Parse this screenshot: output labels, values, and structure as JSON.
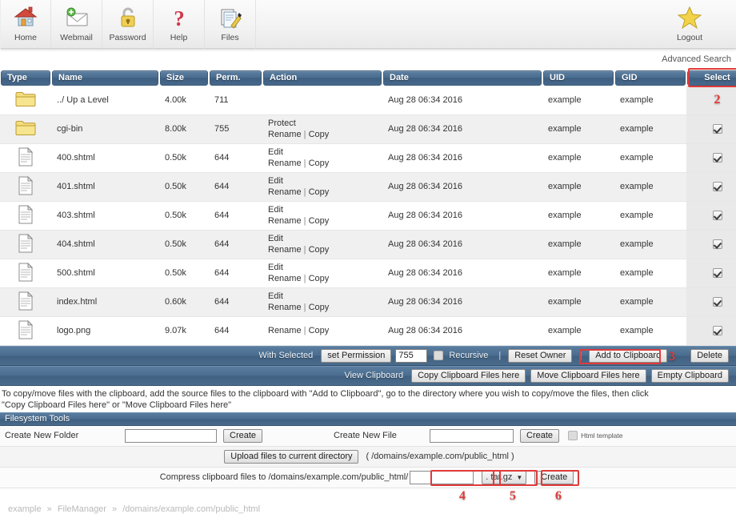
{
  "topnav": {
    "items": [
      {
        "label": "Home",
        "icon": "home-icon"
      },
      {
        "label": "Webmail",
        "icon": "envelope-icon"
      },
      {
        "label": "Password",
        "icon": "padlock-icon"
      },
      {
        "label": "Help",
        "icon": "question-mark-icon"
      },
      {
        "label": "Files",
        "icon": "files-pencil-icon"
      }
    ],
    "logout": {
      "label": "Logout",
      "icon": "star-icon"
    }
  },
  "advanced_search": "Advanced Search",
  "table": {
    "columns": [
      "Type",
      "Name",
      "Size",
      "Perm.",
      "Action",
      "Date",
      "UID",
      "GID",
      "Select"
    ],
    "rows": [
      {
        "type": "folder-icon",
        "name": "../ Up a Level",
        "size": "4.00k",
        "perm": "711",
        "actions": [],
        "date": "Aug 28 06:34 2016",
        "uid": "example",
        "gid": "example",
        "selected": null
      },
      {
        "type": "folder-icon",
        "name": "cgi-bin",
        "size": "8.00k",
        "perm": "755",
        "actions": [
          "Protect",
          "Rename",
          "Copy"
        ],
        "date": "Aug 28 06:34 2016",
        "uid": "example",
        "gid": "example",
        "selected": true
      },
      {
        "type": "file-icon",
        "name": "400.shtml",
        "size": "0.50k",
        "perm": "644",
        "actions": [
          "Edit",
          "Rename",
          "Copy"
        ],
        "date": "Aug 28 06:34 2016",
        "uid": "example",
        "gid": "example",
        "selected": true
      },
      {
        "type": "file-icon",
        "name": "401.shtml",
        "size": "0.50k",
        "perm": "644",
        "actions": [
          "Edit",
          "Rename",
          "Copy"
        ],
        "date": "Aug 28 06:34 2016",
        "uid": "example",
        "gid": "example",
        "selected": true
      },
      {
        "type": "file-icon",
        "name": "403.shtml",
        "size": "0.50k",
        "perm": "644",
        "actions": [
          "Edit",
          "Rename",
          "Copy"
        ],
        "date": "Aug 28 06:34 2016",
        "uid": "example",
        "gid": "example",
        "selected": true
      },
      {
        "type": "file-icon",
        "name": "404.shtml",
        "size": "0.50k",
        "perm": "644",
        "actions": [
          "Edit",
          "Rename",
          "Copy"
        ],
        "date": "Aug 28 06:34 2016",
        "uid": "example",
        "gid": "example",
        "selected": true
      },
      {
        "type": "file-icon",
        "name": "500.shtml",
        "size": "0.50k",
        "perm": "644",
        "actions": [
          "Edit",
          "Rename",
          "Copy"
        ],
        "date": "Aug 28 06:34 2016",
        "uid": "example",
        "gid": "example",
        "selected": true
      },
      {
        "type": "file-icon",
        "name": "index.html",
        "size": "0.60k",
        "perm": "644",
        "actions": [
          "Edit",
          "Rename",
          "Copy"
        ],
        "date": "Aug 28 06:34 2016",
        "uid": "example",
        "gid": "example",
        "selected": true
      },
      {
        "type": "file-icon",
        "name": "logo.png",
        "size": "9.07k",
        "perm": "644",
        "actions": [
          "Rename",
          "Copy"
        ],
        "date": "Aug 28 06:34 2016",
        "uid": "example",
        "gid": "example",
        "selected": true
      }
    ]
  },
  "with_selected": {
    "label": "With Selected",
    "set_permission_button": "set Permission",
    "permission_value": "755",
    "recursive_label": "Recursive",
    "recursive_checked": false,
    "reset_owner_button": "Reset Owner",
    "add_to_clipboard_button": "Add to Clipboard",
    "delete_button": "Delete"
  },
  "clipboard_bar": {
    "view_clipboard": "View Clipboard",
    "copy_here": "Copy Clipboard Files here",
    "move_here": "Move Clipboard Files here",
    "empty_clipboard": "Empty Clipboard"
  },
  "info_text_line1": "To copy/move files with the clipboard, add the source files to the clipboard with \"Add to Clipboard\", go to the directory where you wish to copy/move the files, then click",
  "info_text_line2": "\"Copy Clipboard Files here\" or \"Move Clipboard Files here\"",
  "filesystem_tools": {
    "title": "Filesystem Tools",
    "create_folder_label": "Create New Folder",
    "create_folder_value": "",
    "create_folder_button": "Create",
    "create_file_label": "Create New File",
    "create_file_value": "",
    "create_file_button": "Create",
    "html_template_label": "Html template",
    "html_template_checked": false,
    "upload_button": "Upload files to current directory",
    "upload_path": "( /domains/example.com/public_html )",
    "compress_label": "Compress clipboard files to /domains/example.com/public_html/",
    "compress_value": "",
    "compress_format": ". tar.gz",
    "compress_button": "Create"
  },
  "annotations": {
    "select_header": "2",
    "add_to_clipboard": "3",
    "compress_name": "4",
    "compress_format": "5",
    "compress_create": "6"
  },
  "breadcrumb": {
    "parts": [
      "example",
      "FileManager",
      "/domains/example.com/public_html"
    ],
    "separator": "»"
  },
  "colors": {
    "header_blue": "#46688b",
    "highlight_red": "#e03a3a",
    "row_alt": "#f0f0f0"
  }
}
